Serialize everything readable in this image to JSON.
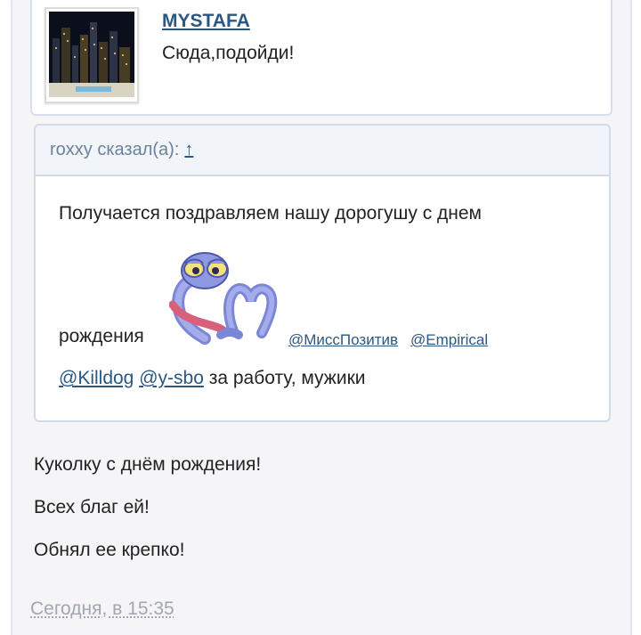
{
  "profile": {
    "username": "MYSTAFA",
    "status": "Сюда,подойди!"
  },
  "quote": {
    "author_line": "roxxy сказал(а):",
    "jump_arrow": "↑",
    "line1": "Получается поздравляем нашу дорогушу с днем",
    "line2_text": "рождения",
    "sticker_icon": "heart-hands-monster-sticker",
    "mention_1": "@МиссПозитив",
    "mention_2": "@Empirical",
    "mention_3": "@Killdog",
    "mention_4": "@y-sbo",
    "line3_tail": " за работу, мужики"
  },
  "message": {
    "lines": [
      "Куколку с днём рождения!",
      "Всех благ ей!",
      "Обнял ее крепко!"
    ]
  },
  "meta": {
    "timestamp": "Сегодня, в 15:35"
  },
  "colors": {
    "link": "#2b5782",
    "quote_header_bg": "#f1f4f8",
    "border": "#d0dbe7"
  }
}
